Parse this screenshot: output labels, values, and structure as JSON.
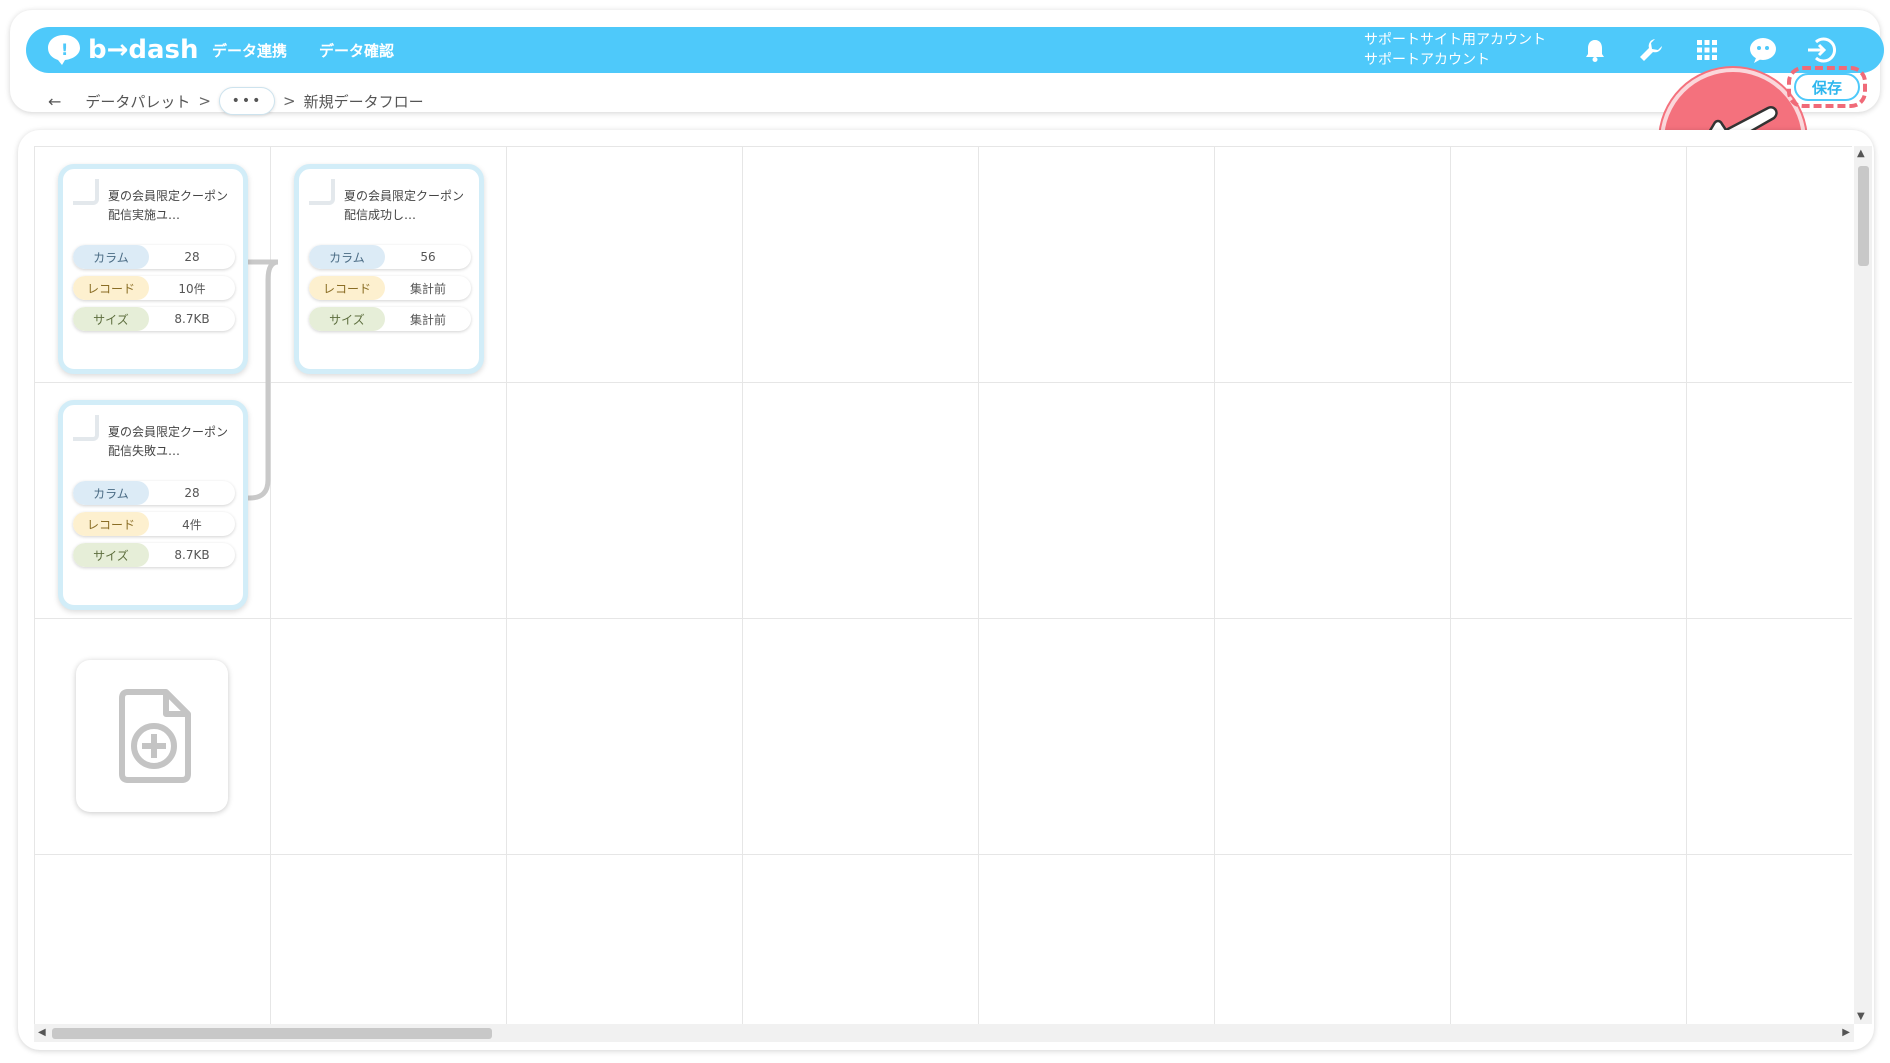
{
  "header": {
    "logo_text": "b→dash",
    "nav": [
      "データ連携",
      "データ確認"
    ],
    "account_line1": "サポートサイト用アカウント",
    "account_line2": "サポートアカウント",
    "brand_color": "#4ec9fa"
  },
  "breadcrumb": {
    "back_icon": "arrow-left-icon",
    "root": "データパレット",
    "separator": ">",
    "collapsed": "•••",
    "current": "新規データフロー"
  },
  "actions": {
    "save_label": "保存",
    "highlight_color": "#f06a78"
  },
  "nodes": [
    {
      "title": "夏の会員限定クーポン 配信実施ユ…",
      "stats": [
        {
          "label": "カラム",
          "value": "28"
        },
        {
          "label": "レコード",
          "value": "10件"
        },
        {
          "label": "サイズ",
          "value": "8.7KB"
        }
      ]
    },
    {
      "title": "夏の会員限定クーポン 配信成功し…",
      "stats": [
        {
          "label": "カラム",
          "value": "56"
        },
        {
          "label": "レコード",
          "value": "集計前"
        },
        {
          "label": "サイズ",
          "value": "集計前"
        }
      ]
    },
    {
      "title": "夏の会員限定クーポン 配信失敗ユ…",
      "stats": [
        {
          "label": "カラム",
          "value": "28"
        },
        {
          "label": "レコード",
          "value": "4件"
        },
        {
          "label": "サイズ",
          "value": "8.7KB"
        }
      ]
    }
  ]
}
